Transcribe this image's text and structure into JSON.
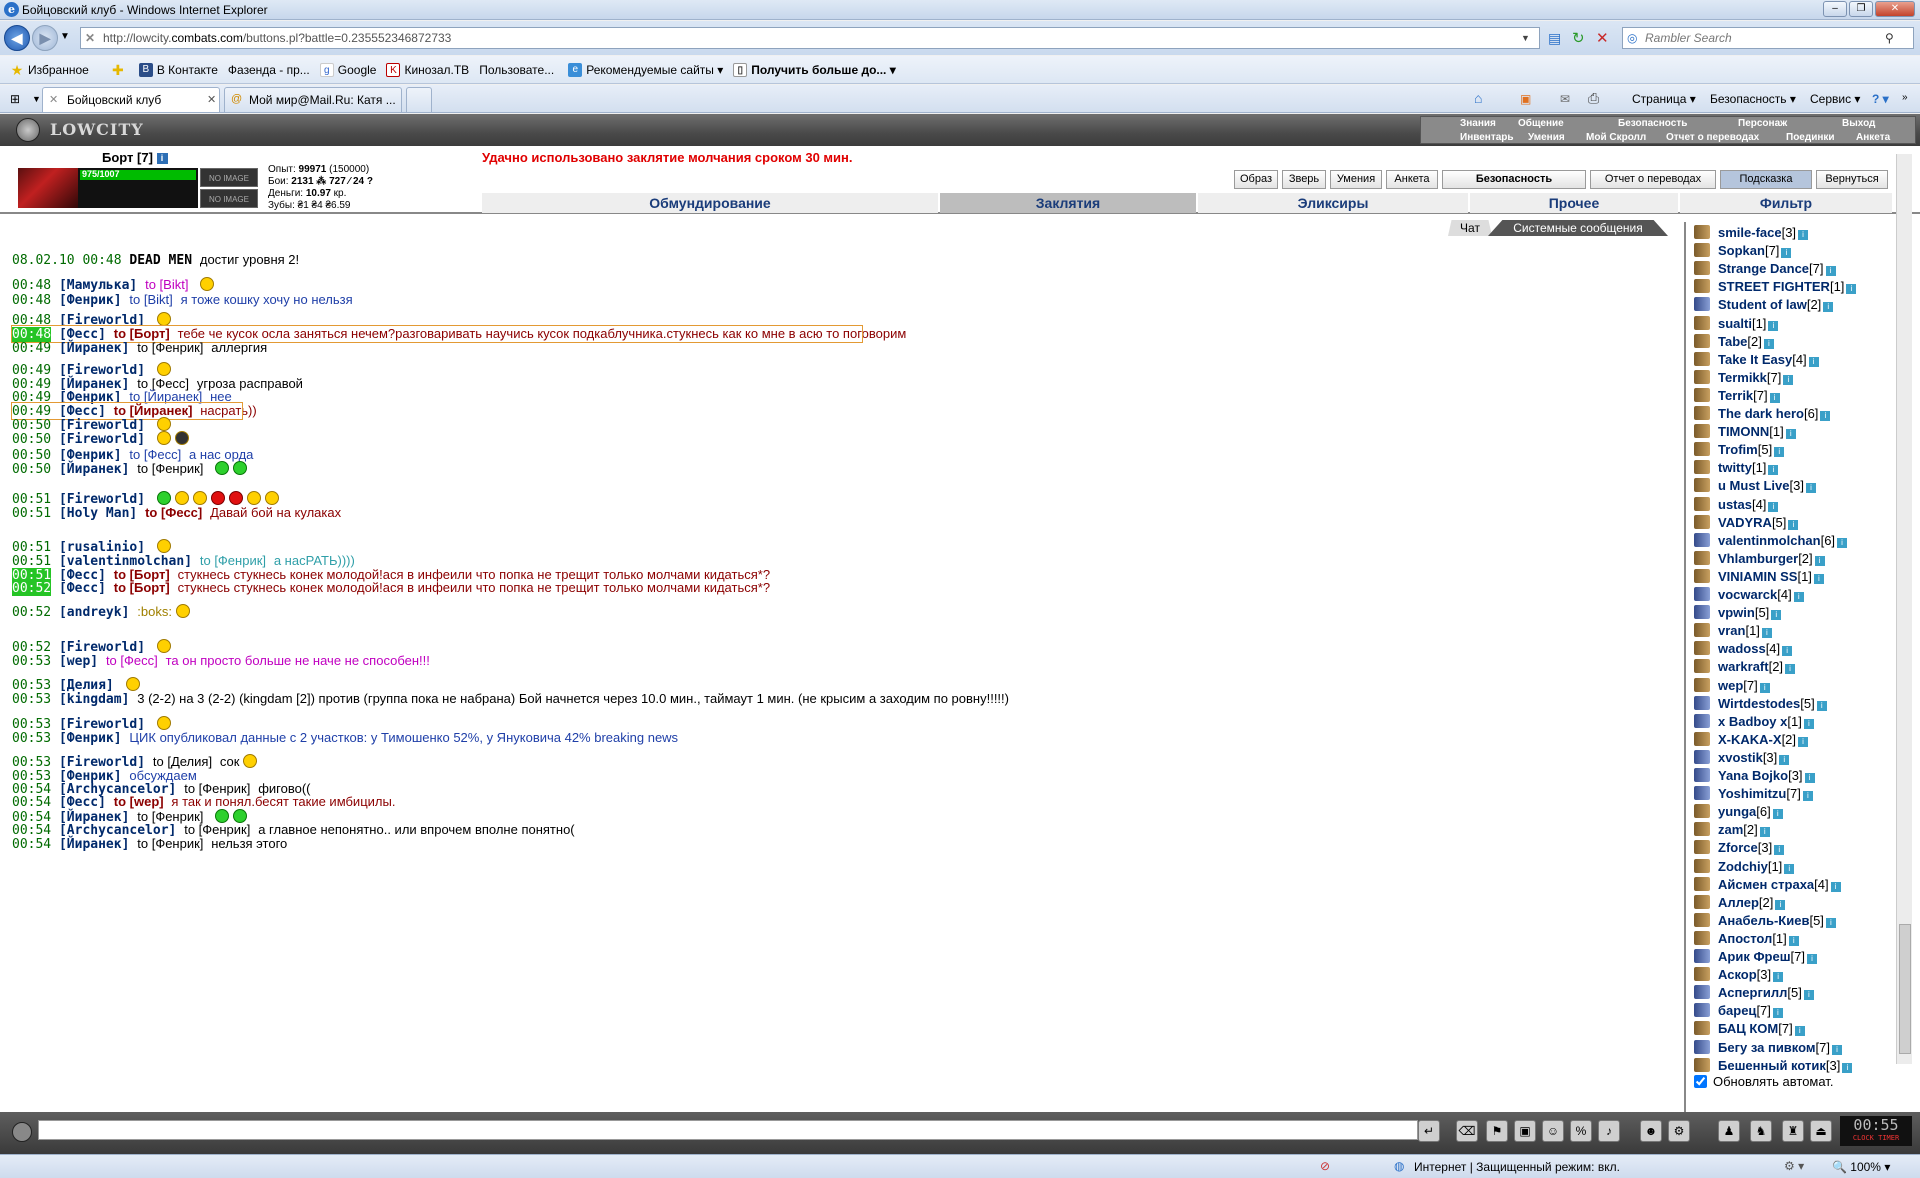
{
  "window": {
    "title": "Бойцовский клуб - Windows Internet Explorer"
  },
  "browser": {
    "url_prefix": "http://lowcity.",
    "url_host": "combats.com",
    "url_path": "/buttons.pl?battle=0.235552346872733",
    "search_placeholder": "Rambler Search",
    "favorites_label": "Избранное",
    "favorites": [
      "В Контакте",
      "Фазенда - пр...",
      "Google",
      "Кинозал.ТВ",
      "Пользовате...",
      "Рекомендуемые сайты ▾",
      "Получить больше до... ▾"
    ],
    "tabs": [
      "Бойцовский клуб",
      "Мой мир@Mail.Ru: Катя ..."
    ],
    "tools": [
      "Страница ▾",
      "Безопасность ▾",
      "Сервис ▾"
    ],
    "status_zone": "Интернет | Защищенный режим: вкл.",
    "zoom": "100%"
  },
  "game": {
    "logo": "LOWCITY",
    "menu_top": [
      "Знания",
      "Общение",
      "Безопасность",
      "Персонаж",
      "Выход"
    ],
    "menu_bottom": [
      "Инвентарь",
      "Умения",
      "Мой Скролл",
      "Отчет о переводах",
      "Поединки",
      "Анкета"
    ],
    "player": {
      "name": "Борт [7]",
      "hp": "975/1007",
      "noimage": "NO IMAGE"
    },
    "stats": {
      "exp_label": "Опыт:",
      "exp": "99971",
      "exp_next": "(150000)",
      "fights_label": "Бои:",
      "fights": "2131 ⁂ 727 ⁄ 24 ?",
      "money_label": "Деньги:",
      "money": "10.97",
      "money_unit": "кр.",
      "teeth_label": "Зубы:",
      "teeth": "₴1 ₴4 ₴6.59"
    },
    "silence_message": "Удачно использовано заклятие молчания сроком 30 мин.",
    "buttons": [
      "Образ",
      "Зверь",
      "Умения",
      "Анкета",
      "Безопасность",
      "Отчет о переводах",
      "Подсказка",
      "Вернуться"
    ],
    "sections": [
      "Обмундирование",
      "Заклятия",
      "Эликсиры",
      "Прочее",
      "Фильтр"
    ],
    "chat_tabs": [
      "Чат",
      "Системные сообщения"
    ],
    "chat": [
      {
        "time": "08.02.10 00:48",
        "nick": "DEAD MEN",
        "to": "",
        "text": "достиг уровня 2!",
        "color": "#000"
      },
      {
        "time": "00:48",
        "nick": "[Мамулька]",
        "to": "to [Bikt]",
        "text": "",
        "color": "#c000c0"
      },
      {
        "time": "00:48",
        "nick": "[Фенрик]",
        "to": "to [Bikt]",
        "text": "я тоже кошку хочу но нельзя",
        "color": "#1f3fa8"
      },
      {
        "time": "00:48",
        "nick": "[Fireworld]",
        "to": "",
        "text": "",
        "color": "#000"
      },
      {
        "time": "00:48",
        "nick": "[Фесс]",
        "to": "to [Борт]",
        "text": "тебе че кусок осла заняться нечем?разговаривать научись кусок подкаблучника.стукнесь как ко мне в асю то поговорим",
        "color": "#8b0000"
      },
      {
        "time": "00:49",
        "nick": "[Йиранек]",
        "to": "to [Фенрик]",
        "text": "аллергия",
        "color": "#000"
      },
      {
        "time": "00:49",
        "nick": "[Fireworld]",
        "to": "",
        "text": "",
        "color": "#000"
      },
      {
        "time": "00:49",
        "nick": "[Йиранек]",
        "to": "to [Фесс]",
        "text": "угроза расправой",
        "color": "#000"
      },
      {
        "time": "00:49",
        "nick": "[Фенрик]",
        "to": "to [Йиранек]",
        "text": "нее",
        "color": "#1f3fa8"
      },
      {
        "time": "00:49",
        "nick": "[Фесс]",
        "to": "to [Йиранек]",
        "text": "насрать))",
        "color": "#8b0000"
      },
      {
        "time": "00:50",
        "nick": "[Fireworld]",
        "to": "",
        "text": "",
        "color": "#000"
      },
      {
        "time": "00:50",
        "nick": "[Fireworld]",
        "to": "",
        "text": "",
        "color": "#000"
      },
      {
        "time": "00:50",
        "nick": "[Фенрик]",
        "to": "to [Фесс]",
        "text": "а нас орда",
        "color": "#1f3fa8"
      },
      {
        "time": "00:50",
        "nick": "[Йиранек]",
        "to": "to [Фенрик]",
        "text": "",
        "color": "#000"
      },
      {
        "time": "00:51",
        "nick": "[Fireworld]",
        "to": "",
        "text": "",
        "color": "#000"
      },
      {
        "time": "00:51",
        "nick": "[Holy Man]",
        "to": "to [Фесс]",
        "text": "Давай бой на кулаках",
        "color": "#8b0000"
      },
      {
        "time": "00:51",
        "nick": "[rusalinio]",
        "to": "",
        "text": "",
        "color": "#000"
      },
      {
        "time": "00:51",
        "nick": "[valentinmolchan]",
        "to": "to [Фенрик]",
        "text": "а насРАТЬ))))",
        "color": "#2f9fa8"
      },
      {
        "time": "00:51",
        "nick": "[Фесс]",
        "to": "to [Борт]",
        "text": "стукнесь стукнесь конек молодой!ася в инфеили что попка не трещит только молчами кидаться*?",
        "color": "#8b0000"
      },
      {
        "time": "00:52",
        "nick": "[Фесс]",
        "to": "to [Борт]",
        "text": "стукнесь стукнесь конек молодой!ася в инфеили что попка не трещит только молчами кидаться*?",
        "color": "#8b0000"
      },
      {
        "time": "00:52",
        "nick": "[andreyk]",
        "to": "",
        "text": ":boks:",
        "color": "#a08000"
      },
      {
        "time": "00:52",
        "nick": "[Fireworld]",
        "to": "",
        "text": "",
        "color": "#000"
      },
      {
        "time": "00:53",
        "nick": "[wep]",
        "to": "to [Фесс]",
        "text": "та он просто больше не наче не способен!!!",
        "color": "#c000c0"
      },
      {
        "time": "00:53",
        "nick": "[Делия]",
        "to": "",
        "text": "",
        "color": "#000"
      },
      {
        "time": "00:53",
        "nick": "[kingdam]",
        "to": "",
        "text": "3 (2-2) на 3 (2-2) (kingdam [2]) против (группа пока не набрана) Бой начнется через 10.0 мин., таймаут 1 мин. (не крысим а заходим по ровну!!!!!)",
        "color": "#000"
      },
      {
        "time": "00:53",
        "nick": "[Fireworld]",
        "to": "",
        "text": "",
        "color": "#000"
      },
      {
        "time": "00:53",
        "nick": "[Фенрик]",
        "to": "",
        "text": "ЦИК опубликовал данные с 2 участков: у Тимошенко 52%, у Януковича 42% breaking news",
        "color": "#1f3fa8"
      },
      {
        "time": "00:53",
        "nick": "[Fireworld]",
        "to": "to [Делия]",
        "text": "сок",
        "color": "#000"
      },
      {
        "time": "00:53",
        "nick": "[Фенрик]",
        "to": "",
        "text": "обсуждаем",
        "color": "#1f3fa8"
      },
      {
        "time": "00:54",
        "nick": "[Archycancelor]",
        "to": "to [Фенрик]",
        "text": "фигово((",
        "color": "#000"
      },
      {
        "time": "00:54",
        "nick": "[Фесс]",
        "to": "to [wep]",
        "text": "я так и понял.бесят такие имбицилы.",
        "color": "#8b0000"
      },
      {
        "time": "00:54",
        "nick": "[Йиранек]",
        "to": "to [Фенрик]",
        "text": "",
        "color": "#000"
      },
      {
        "time": "00:54",
        "nick": "[Archycancelor]",
        "to": "to [Фенрик]",
        "text": "а главное непонятно.. или впрочем вполне понятно(",
        "color": "#000"
      },
      {
        "time": "00:54",
        "nick": "[Йиранек]",
        "to": "to [Фенрик]",
        "text": "нельзя этого",
        "color": "#000"
      }
    ],
    "users": [
      {
        "n": "smile-face",
        "l": "[3]"
      },
      {
        "n": "Sopkan",
        "l": "[7]"
      },
      {
        "n": "Strange Dance",
        "l": "[7]"
      },
      {
        "n": "STREET FIGHTER",
        "l": "[1]"
      },
      {
        "n": "Student of law",
        "l": "[2]"
      },
      {
        "n": "sualti",
        "l": "[1]"
      },
      {
        "n": "Tabe",
        "l": "[2]"
      },
      {
        "n": "Take It Easy",
        "l": "[4]"
      },
      {
        "n": "Termikk",
        "l": "[7]"
      },
      {
        "n": "Terrik",
        "l": "[7]"
      },
      {
        "n": "The dark hero",
        "l": "[6]"
      },
      {
        "n": "TIMONN",
        "l": "[1]"
      },
      {
        "n": "Trofim",
        "l": "[5]"
      },
      {
        "n": "twitty",
        "l": "[1]"
      },
      {
        "n": "u Must Live",
        "l": "[3]"
      },
      {
        "n": "ustas",
        "l": "[4]"
      },
      {
        "n": "VADYRA",
        "l": "[5]"
      },
      {
        "n": "valentinmolchan",
        "l": "[6]"
      },
      {
        "n": "Vhlamburger",
        "l": "[2]"
      },
      {
        "n": "VINIAMIN SS",
        "l": "[1]"
      },
      {
        "n": "vocwarck",
        "l": "[4]"
      },
      {
        "n": "vpwin",
        "l": "[5]"
      },
      {
        "n": "vran",
        "l": "[1]"
      },
      {
        "n": "wadoss",
        "l": "[4]"
      },
      {
        "n": "warkraft",
        "l": "[2]"
      },
      {
        "n": "wep",
        "l": "[7]"
      },
      {
        "n": "Wirtdestodes",
        "l": "[5]"
      },
      {
        "n": "x Badboy x",
        "l": "[1]"
      },
      {
        "n": "X-KAKA-X",
        "l": "[2]"
      },
      {
        "n": "xvostik",
        "l": "[3]"
      },
      {
        "n": "Yana Bojko",
        "l": "[3]"
      },
      {
        "n": "Yoshimitzu",
        "l": "[7]"
      },
      {
        "n": "yunga",
        "l": "[6]"
      },
      {
        "n": "zam",
        "l": "[2]"
      },
      {
        "n": "Zforce",
        "l": "[3]"
      },
      {
        "n": "Zodchiy",
        "l": "[1]"
      },
      {
        "n": "Айсмен страха",
        "l": "[4]"
      },
      {
        "n": "Аллер",
        "l": "[2]"
      },
      {
        "n": "Анабель-Киев",
        "l": "[5]"
      },
      {
        "n": "Апостол",
        "l": "[1]"
      },
      {
        "n": "Арик Фреш",
        "l": "[7]"
      },
      {
        "n": "Аскор",
        "l": "[3]"
      },
      {
        "n": "Аспергилл",
        "l": "[5]"
      },
      {
        "n": "барец",
        "l": "[7]"
      },
      {
        "n": "БАЦ КОМ",
        "l": "[7]"
      },
      {
        "n": "Бегу за пивком",
        "l": "[7]"
      },
      {
        "n": "Бешенный котик",
        "l": "[3]"
      }
    ],
    "auto_update": "Обновлять автомат.",
    "clock": "00:55",
    "clock_sub": "CLOCK TIMER"
  }
}
